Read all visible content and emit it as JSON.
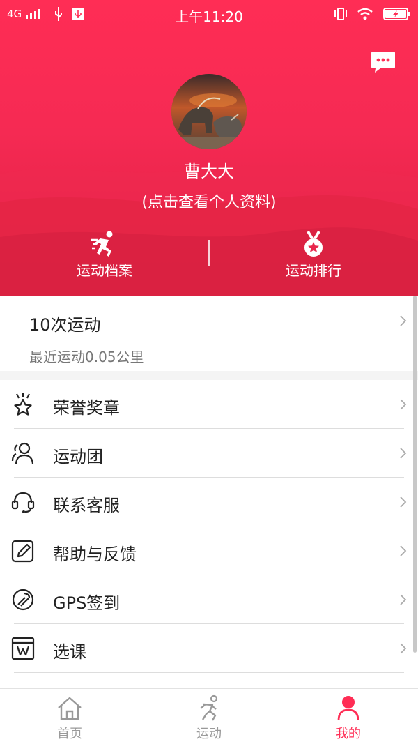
{
  "status_bar": {
    "network": "4G",
    "time": "上午11:20"
  },
  "profile": {
    "name": "曹大大",
    "view_profile": "(点击查看个人资料)"
  },
  "quick_actions": [
    {
      "label": "运动档案",
      "icon": "running-figure-icon"
    },
    {
      "label": "运动排行",
      "icon": "medal-star-icon"
    }
  ],
  "summary": {
    "count": "10次运动",
    "recent": "最近运动0.05公里"
  },
  "menu": [
    {
      "label": "荣誉奖章",
      "icon": "honor-medal-icon"
    },
    {
      "label": "运动团",
      "icon": "group-users-icon"
    },
    {
      "label": "联系客服",
      "icon": "headset-icon"
    },
    {
      "label": "帮助与反馈",
      "icon": "edit-feedback-icon"
    },
    {
      "label": "GPS签到",
      "icon": "gps-location-icon"
    },
    {
      "label": "选课",
      "icon": "course-select-icon"
    }
  ],
  "tabs": [
    {
      "label": "首页",
      "icon": "home-icon",
      "active": false
    },
    {
      "label": "运动",
      "icon": "running-figure-icon",
      "active": false
    },
    {
      "label": "我的",
      "icon": "user-profile-icon",
      "active": true
    }
  ],
  "colors": {
    "accent": "#ff2d55",
    "hero_dark": "#d71f42",
    "muted_text": "#777777"
  }
}
